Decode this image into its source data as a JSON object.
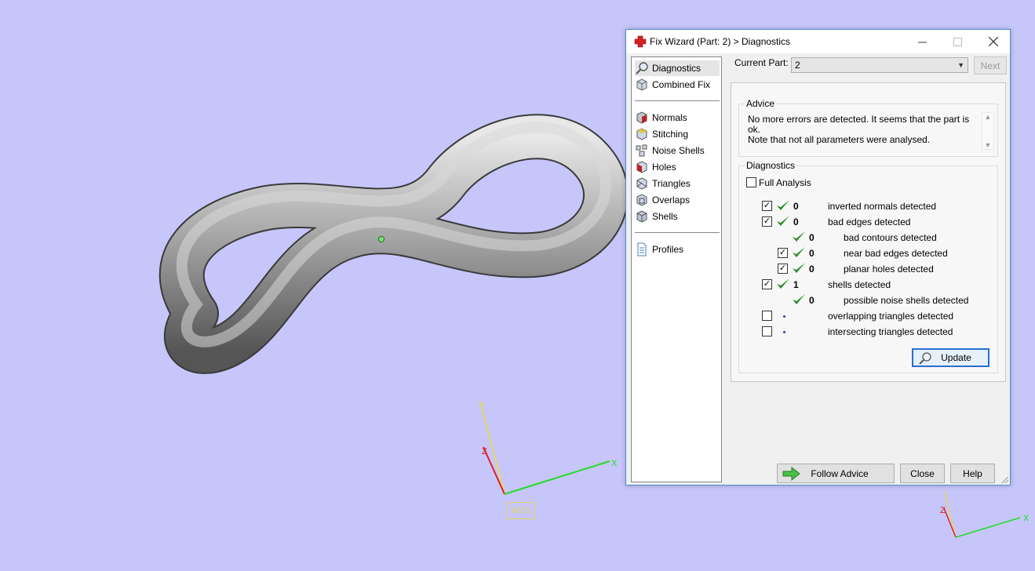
{
  "window": {
    "title": "Fix Wizard (Part: 2) > Diagnostics"
  },
  "viewport": {
    "wcs_label": "WCS",
    "axis_x": "X",
    "axis_y": "Y",
    "axis_z": "Z"
  },
  "nav": {
    "items": [
      {
        "label": "Diagnostics",
        "icon": "magnifier-icon"
      },
      {
        "label": "Combined Fix",
        "icon": "cube-icon"
      },
      {
        "label": "Normals",
        "icon": "normals-cube-icon"
      },
      {
        "label": "Stitching",
        "icon": "stitching-cube-icon"
      },
      {
        "label": "Noise Shells",
        "icon": "noise-shells-icon"
      },
      {
        "label": "Holes",
        "icon": "holes-cube-icon"
      },
      {
        "label": "Triangles",
        "icon": "triangles-cube-icon"
      },
      {
        "label": "Overlaps",
        "icon": "overlaps-cube-icon"
      },
      {
        "label": "Shells",
        "icon": "shells-cube-icon"
      },
      {
        "label": "Profiles",
        "icon": "document-icon"
      }
    ]
  },
  "current_part": {
    "label": "Current Part:",
    "value": "2",
    "next_label": "Next"
  },
  "advice": {
    "title": "Advice",
    "line1": "No more errors are detected. It seems that the part is ok.",
    "line2": "Note that not all parameters were analysed."
  },
  "diagnostics": {
    "title": "Diagnostics",
    "full_analysis_label": "Full Analysis",
    "full_analysis_checked": false,
    "rows": [
      {
        "checked": true,
        "status": "ok",
        "count": "0",
        "label": "inverted normals detected"
      },
      {
        "checked": true,
        "status": "ok",
        "count": "0",
        "label": "bad edges detected"
      },
      {
        "checked": null,
        "status": "ok",
        "count": "0",
        "label": "bad contours detected"
      },
      {
        "checked": true,
        "status": "ok",
        "count": "0",
        "label": "near bad edges detected"
      },
      {
        "checked": true,
        "status": "ok",
        "count": "0",
        "label": "planar holes detected"
      },
      {
        "checked": true,
        "status": "ok",
        "count": "1",
        "label": "shells detected"
      },
      {
        "checked": null,
        "status": "ok",
        "count": "0",
        "label": "possible noise shells detected"
      },
      {
        "checked": false,
        "status": "pending",
        "count": "",
        "label": "overlapping triangles detected"
      },
      {
        "checked": false,
        "status": "pending",
        "count": "",
        "label": "intersecting triangles detected"
      }
    ],
    "update_label": "Update"
  },
  "footer": {
    "follow_advice_label": "Follow Advice",
    "close_label": "Close",
    "help_label": "Help"
  },
  "colors": {
    "background": "#c6c6fb",
    "check_green": "#2e8b2e",
    "accent_blue": "#2a6fd1",
    "wcs_yellow": "#e6d860"
  }
}
